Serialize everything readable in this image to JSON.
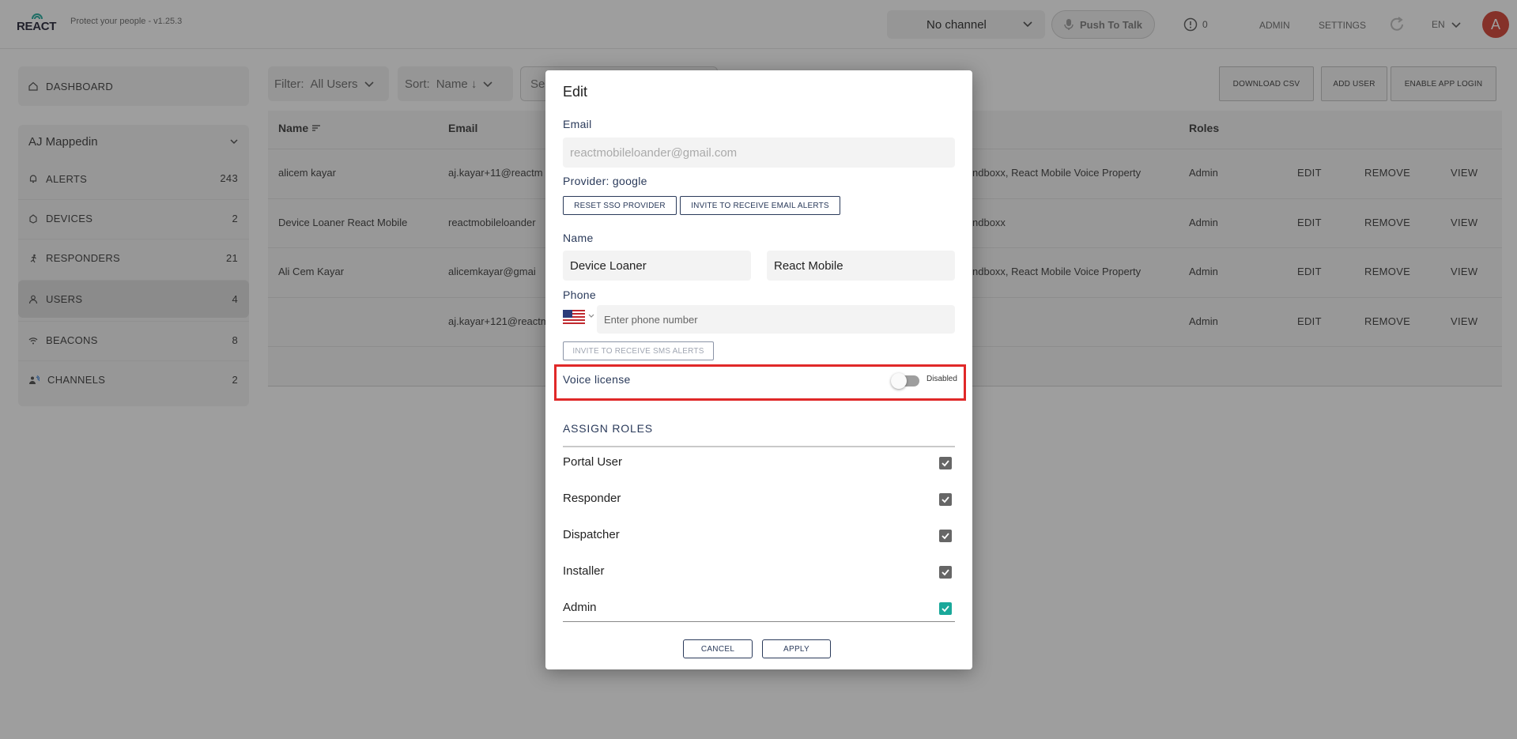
{
  "header": {
    "logo_text": "REACT",
    "tagline": "Protect your people - v1.25.3",
    "channel": "No channel",
    "push_to_talk": "Push To Talk",
    "alert_count": "0",
    "nav": {
      "admin": "ADMIN",
      "settings": "SETTINGS"
    },
    "language": "EN",
    "avatar_initial": "A"
  },
  "sidebar": {
    "dashboard": "DASHBOARD",
    "org_name": "AJ Mappedin",
    "items": [
      {
        "label": "ALERTS",
        "count": "243",
        "icon": "bell-icon"
      },
      {
        "label": "DEVICES",
        "count": "2",
        "icon": "device-icon"
      },
      {
        "label": "RESPONDERS",
        "count": "21",
        "icon": "runner-icon"
      },
      {
        "label": "USERS",
        "count": "4",
        "icon": "user-icon",
        "active": true
      },
      {
        "label": "BEACONS",
        "count": "8",
        "icon": "wifi-icon"
      },
      {
        "label": "CHANNELS",
        "count": "2",
        "icon": "people-icon"
      }
    ]
  },
  "toolbar": {
    "filter_label": "Filter:",
    "filter_value": "All Users",
    "sort_label": "Sort:",
    "sort_value": "Name ↓",
    "search_placeholder": "Se",
    "download_csv": "DOWNLOAD CSV",
    "add_user": "ADD USER",
    "enable_app_login": "ENABLE APP LOGIN"
  },
  "table": {
    "headers": {
      "name": "Name",
      "email": "Email",
      "roles": "Roles"
    },
    "rows": [
      {
        "name": "alicem kayar",
        "email": "aj.kayar+11@reactm",
        "channels": "ndboxx, React Mobile Voice Property",
        "role": "Admin"
      },
      {
        "name": "Device Loaner React Mobile",
        "email": "reactmobileloander",
        "channels": "ndboxx",
        "role": "Admin"
      },
      {
        "name": "Ali Cem Kayar",
        "email": "alicemkayar@gmai",
        "channels": "ndboxx, React Mobile Voice Property",
        "role": "Admin"
      },
      {
        "name": "",
        "email": "aj.kayar+121@reactm",
        "channels": "",
        "role": "Admin"
      }
    ],
    "actions": {
      "edit": "EDIT",
      "remove": "REMOVE",
      "view": "VIEW"
    }
  },
  "modal": {
    "title": "Edit",
    "email_label": "Email",
    "email_value": "reactmobileloander@gmail.com",
    "provider": "Provider: google",
    "reset_sso": "RESET SSO PROVIDER",
    "invite_email": "INVITE TO RECEIVE EMAIL ALERTS",
    "name_label": "Name",
    "first_name": "Device Loaner",
    "last_name": "React Mobile",
    "phone_label": "Phone",
    "phone_placeholder": "Enter phone number",
    "invite_sms": "INVITE TO RECEIVE SMS ALERTS",
    "voice_license_label": "Voice license",
    "voice_license_state": "Disabled",
    "assign_roles": "ASSIGN ROLES",
    "roles": [
      {
        "label": "Portal User",
        "checked": true
      },
      {
        "label": "Responder",
        "checked": true
      },
      {
        "label": "Dispatcher",
        "checked": true
      },
      {
        "label": "Installer",
        "checked": true
      },
      {
        "label": "Admin",
        "checked": true
      }
    ],
    "cancel": "CANCEL",
    "apply": "APPLY"
  },
  "colors": {
    "accent": "#d23a2a",
    "highlight": "#e02828",
    "checkbox_teal": "#1aa89a",
    "checkbox_gray": "#666666",
    "navy": "#2a3a5a"
  }
}
